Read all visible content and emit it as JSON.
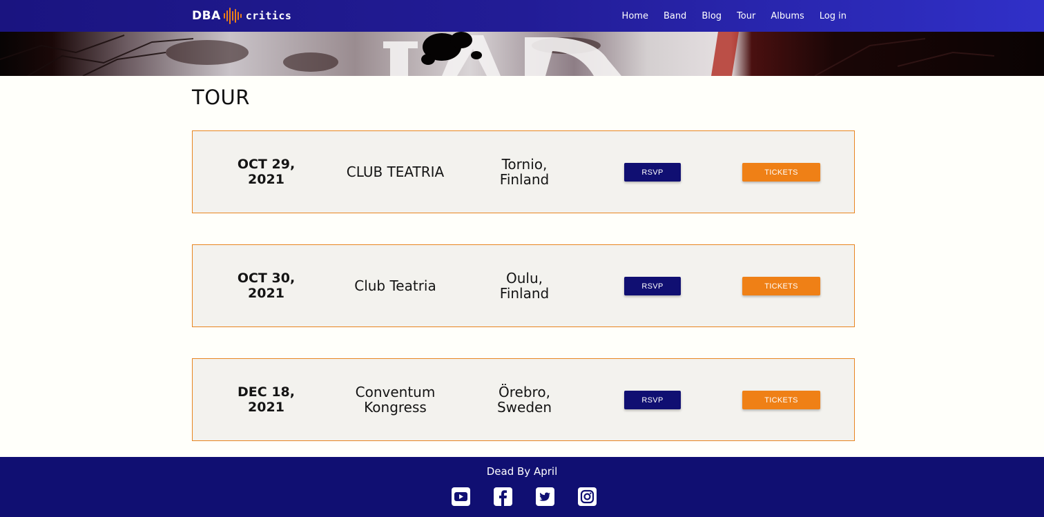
{
  "nav": {
    "logo_left": "DBA",
    "logo_right": "critics",
    "links": [
      "Home",
      "Band",
      "Blog",
      "Tour",
      "Albums",
      "Log in"
    ]
  },
  "page": {
    "title": "TOUR"
  },
  "tour": [
    {
      "date_line1": "OCT 29,",
      "date_line2": "2021",
      "venue_line1": "CLUB TEATRIA",
      "venue_line2": "",
      "city_line1": "Tornio,",
      "city_line2": "Finland",
      "rsvp": "RSVP",
      "tickets": "TICKETS"
    },
    {
      "date_line1": "OCT 30,",
      "date_line2": "2021",
      "venue_line1": "Club Teatria",
      "venue_line2": "",
      "city_line1": "Oulu,",
      "city_line2": "Finland",
      "rsvp": "RSVP",
      "tickets": "TICKETS"
    },
    {
      "date_line1": "DEC 18,",
      "date_line2": "2021",
      "venue_line1": "Conventum",
      "venue_line2": "Kongress",
      "city_line1": "Örebro,",
      "city_line2": "Sweden",
      "rsvp": "RSVP",
      "tickets": "TICKETS"
    }
  ],
  "footer": {
    "title": "Dead By April",
    "socials": [
      "youtube-icon",
      "facebook-icon",
      "twitter-icon",
      "instagram-icon"
    ]
  },
  "colors": {
    "nav_bg": "#1a1480",
    "accent_orange": "#ef8016",
    "rsvp_navy": "#100f72",
    "row_bg": "#f3f2ee",
    "page_bg": "#fffffa"
  }
}
